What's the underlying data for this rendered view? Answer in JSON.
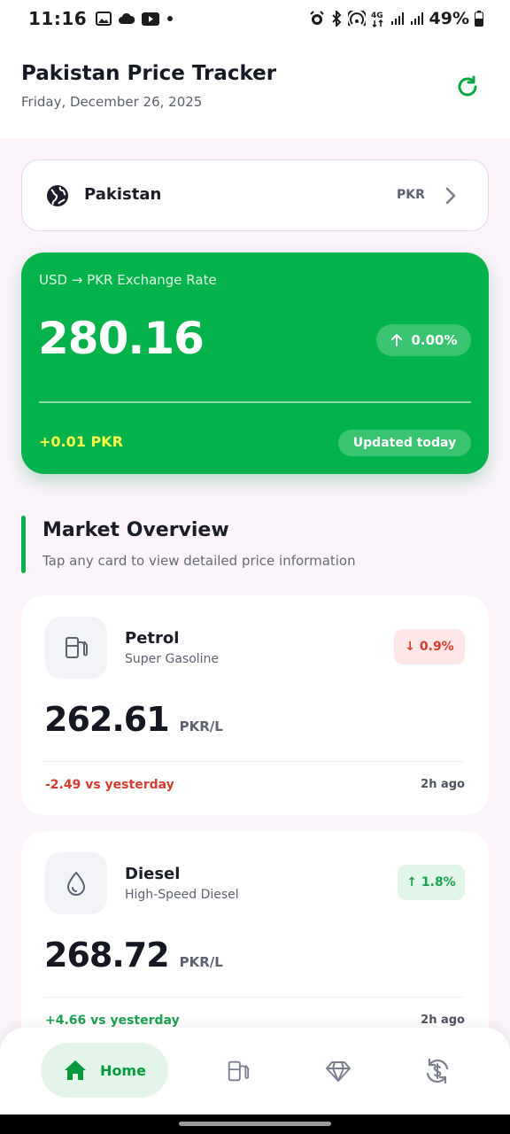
{
  "status_bar": {
    "time": "11:16",
    "battery": "49%",
    "network": "4G"
  },
  "header": {
    "title": "Pakistan Price Tracker",
    "date": "Friday, December 26, 2025"
  },
  "country": {
    "name": "Pakistan",
    "currency": "PKR"
  },
  "exchange": {
    "label": "USD → PKR Exchange Rate",
    "value": "280.16",
    "change_percent": "0.00%",
    "delta": "+0.01 PKR",
    "updated": "Updated today"
  },
  "market": {
    "title": "Market Overview",
    "subtitle": "Tap any card to view detailed price information",
    "items": [
      {
        "name": "Petrol",
        "subtitle": "Super Gasoline",
        "badge": "↓ 0.9%",
        "price": "262.61",
        "unit": "PKR/L",
        "delta": "-2.49 vs yesterday",
        "time": "2h ago",
        "icon": "fuel-pump-icon"
      },
      {
        "name": "Diesel",
        "subtitle": "High-Speed Diesel",
        "badge": "↑ 1.8%",
        "price": "268.72",
        "unit": "PKR/L",
        "delta": "+4.66 vs yesterday",
        "time": "2h ago",
        "icon": "droplet-icon"
      }
    ]
  },
  "nav": {
    "home_label": "Home"
  },
  "colors": {
    "accent": "#03b24a",
    "delta_highlight": "#f7ff4a",
    "down": "#d63b2f",
    "up": "#1aa251"
  }
}
